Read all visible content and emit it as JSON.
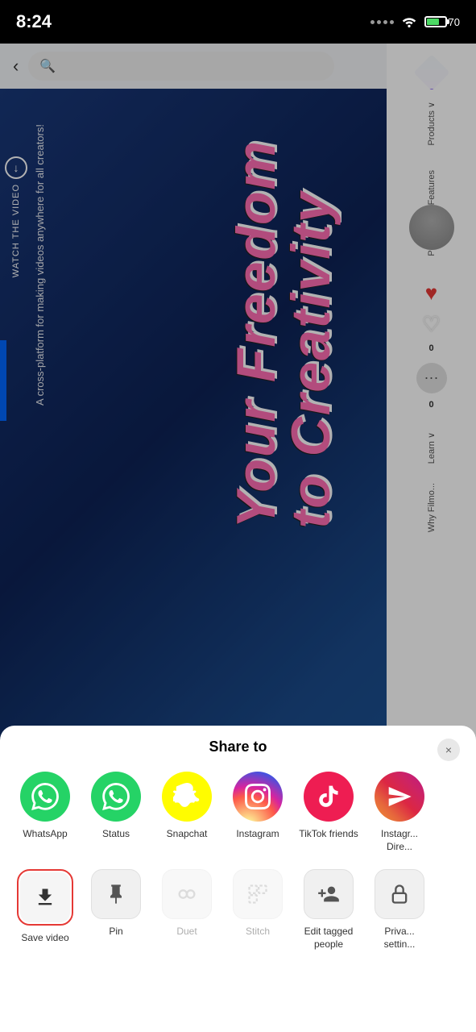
{
  "statusBar": {
    "time": "8:24",
    "battery": "70"
  },
  "nav": {
    "back_label": "‹",
    "search_placeholder": ""
  },
  "videoContent": {
    "title": "Your Freedom to Creativity",
    "subtitle": "A cross-platform for making videos anywhere for all creators!",
    "watchButton": "WATCH THE VIDEO"
  },
  "sidePanel": {
    "items": [
      "Products",
      "Features",
      "Pricing",
      "Learn",
      "Why Filmo"
    ]
  },
  "shareSheet": {
    "title": "Share to",
    "close_label": "×",
    "apps": [
      {
        "id": "whatsapp",
        "label": "WhatsApp",
        "icon": "whatsapp"
      },
      {
        "id": "status",
        "label": "Status",
        "icon": "status"
      },
      {
        "id": "snapchat",
        "label": "Snapchat",
        "icon": "snapchat"
      },
      {
        "id": "instagram",
        "label": "Instagram",
        "icon": "instagram"
      },
      {
        "id": "tiktok-friends",
        "label": "TikTok friends",
        "icon": "tiktok"
      },
      {
        "id": "instagram-direct",
        "label": "Instagr... Dire...",
        "icon": "instagram-direct"
      }
    ],
    "actions": [
      {
        "id": "save-video",
        "label": "Save video",
        "highlighted": true
      },
      {
        "id": "pin",
        "label": "Pin",
        "highlighted": false
      },
      {
        "id": "duet",
        "label": "Duet",
        "disabled": true
      },
      {
        "id": "stitch",
        "label": "Stitch",
        "disabled": true
      },
      {
        "id": "edit-tagged",
        "label": "Edit tagged people",
        "disabled": false
      },
      {
        "id": "privacy-settings",
        "label": "Priva... settin...",
        "disabled": false
      }
    ]
  }
}
